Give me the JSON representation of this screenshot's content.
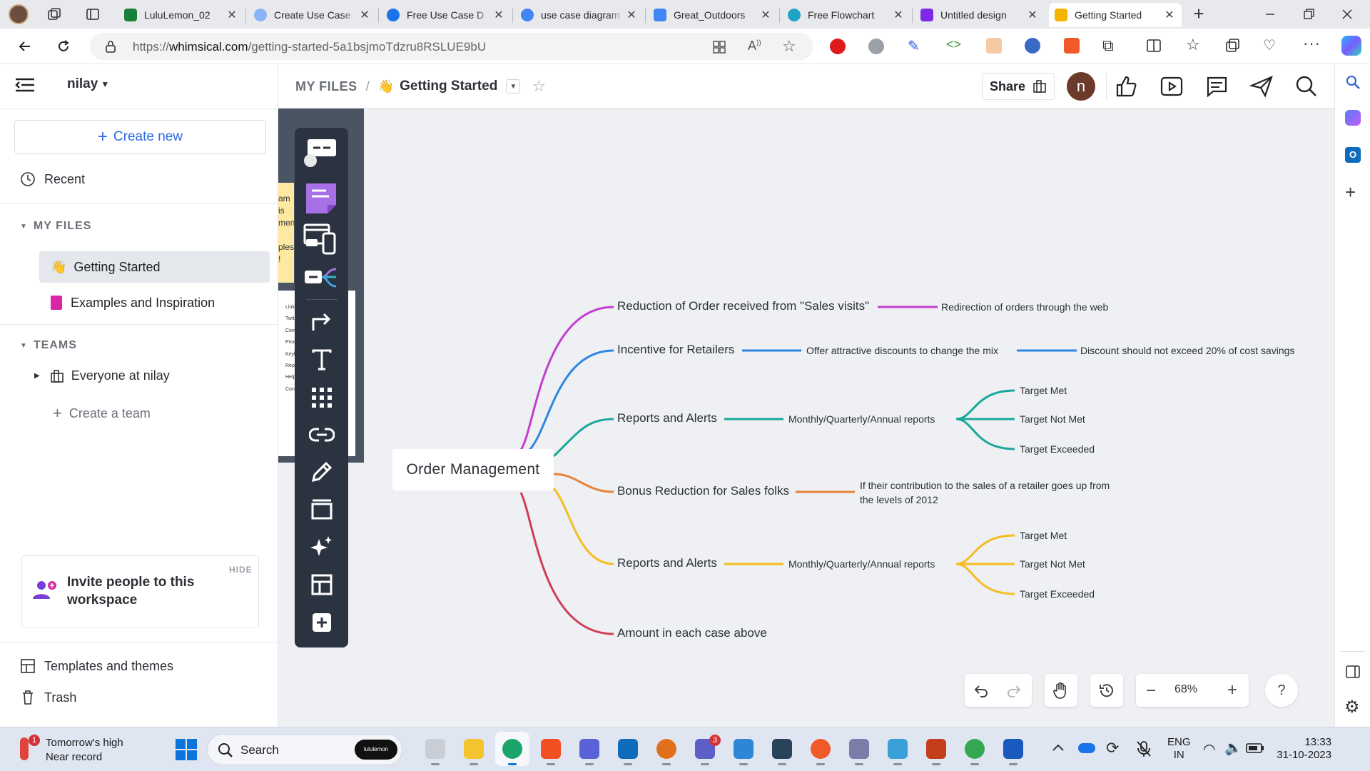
{
  "browser": {
    "tabs": [
      {
        "title": "LuluLemon_02",
        "icon": "sheets-icon",
        "color": "#188038"
      },
      {
        "title": "Create Use Case",
        "icon": "loading-icon",
        "color": "#8ab4f8"
      },
      {
        "title": "Free Use Case D",
        "icon": "gear-blue-icon",
        "color": "#1a73e8"
      },
      {
        "title": "use case diagram",
        "icon": "google-icon",
        "color": "#4285f4"
      },
      {
        "title": "Great_Outdoors",
        "icon": "docs-icon",
        "color": "#4285f4"
      },
      {
        "title": "Free Flowchart",
        "icon": "flowchart-icon",
        "color": "#1ea5c6"
      },
      {
        "title": "Untitled design",
        "icon": "canva-icon",
        "color": "#7d2ae8"
      },
      {
        "title": "Getting Started",
        "icon": "wave-icon",
        "color": "#f5b400",
        "active": true
      }
    ],
    "url_prefix": "https://",
    "url_host": "whimsical.com",
    "url_path": "/getting-started-5a1bsjmoTdzru8RSLUE9bU"
  },
  "sidebar": {
    "workspace": "nilay",
    "create_new": "Create new",
    "recent": "Recent",
    "my_files_header": "MY FILES",
    "files": [
      {
        "label": "Getting Started",
        "icon": "wave-icon",
        "selected": true
      },
      {
        "label": "Examples and Inspiration",
        "icon": "pink-doc-icon",
        "selected": false
      }
    ],
    "teams_header": "TEAMS",
    "team": "Everyone at nilay",
    "create_team": "Create a team",
    "invite_title": "Invite people to this workspace",
    "hide": "HIDE",
    "templates": "Templates and themes",
    "trash": "Trash"
  },
  "topbar": {
    "breadcrumb_root": "MY FILES",
    "separator": "/",
    "file_title": "Getting Started",
    "share": "Share",
    "avatar_letter": "n"
  },
  "mindmap": {
    "root": "Order Management",
    "branches": [
      {
        "label": "Reduction of Order received from \"Sales visits\"",
        "color": "#c23ed1",
        "children": [
          "Redirection of orders through the web"
        ]
      },
      {
        "label": "Incentive for Retailers",
        "color": "#2e86de",
        "children": [
          "Offer attractive discounts to change the mix",
          "Discount should not exceed 20% of cost savings"
        ]
      },
      {
        "label": "Reports and Alerts",
        "color": "#1aa79c",
        "children": [
          "Monthly/Quarterly/Annual reports"
        ],
        "leaves": [
          "Target Met",
          "Target Not Met",
          "Target Exceeded"
        ]
      },
      {
        "label": "Bonus Reduction for Sales folks",
        "color": "#e8833a",
        "children": [
          "If their contribution to the sales of a retailer goes up from",
          "the levels of 2012"
        ]
      },
      {
        "label": "Reports and Alerts",
        "color": "#f5bd22",
        "children": [
          "Monthly/Quarterly/Annual reports"
        ],
        "leaves": [
          "Target Met",
          "Target Not Met",
          "Target Exceeded"
        ]
      },
      {
        "label": "Amount in each case above",
        "color": "#d13c5a",
        "children": []
      }
    ]
  },
  "sticky_note": {
    "lines": [
      "am is",
      "menu",
      "",
      "ples",
      "!"
    ]
  },
  "list_card": {
    "items": [
      "Link",
      "Twit",
      "Com",
      "Proc",
      "Keyl",
      "Rep",
      "Help",
      "Cont"
    ]
  },
  "bottom_controls": {
    "zoom": "68%",
    "help": "?"
  },
  "taskbar": {
    "weather_line1": "Tomorrow's high",
    "weather_line2": "Near record",
    "weather_badge": "1",
    "search": "Search",
    "search_badge": "lululemon",
    "teams_badge": "3",
    "lang1": "ENG",
    "lang2": "IN",
    "time": "13:33",
    "date": "31-10-2023"
  }
}
